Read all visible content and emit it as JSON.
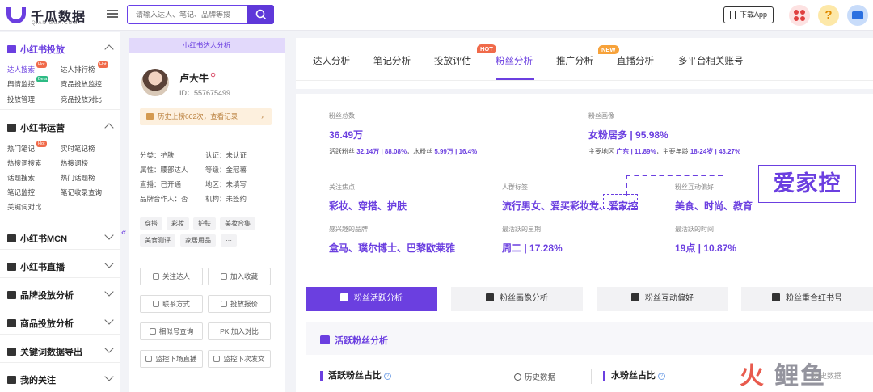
{
  "app": {
    "logo_name": "千瓜数据",
    "logo_sub": "QIAN-GUA.COM"
  },
  "search": {
    "placeholder": "请输入达人、笔记、品牌等搜"
  },
  "topbar": {
    "download_label": "下载App",
    "help_glyph": "?"
  },
  "sidebar": {
    "groups": [
      {
        "title": "小红书投放",
        "items": [
          "达人搜索",
          "达人排行榜",
          "舆情监控",
          "竞品投放监控",
          "投放管理",
          "竞品投放对比"
        ],
        "tags": {
          "hot1": "Hot",
          "hot2": "Hot",
          "beta": "Beta"
        }
      },
      {
        "title": "小红书运营",
        "items": [
          "热门笔记",
          "实时笔记榜",
          "热搜词搜索",
          "热搜词榜",
          "话题搜索",
          "热门话题榜",
          "笔记监控",
          "笔记收录查询",
          "关键词对比"
        ],
        "tags": {
          "hot": "Hot"
        }
      },
      {
        "title": "小红书MCN"
      },
      {
        "title": "小红书直播"
      },
      {
        "title": "品牌投放分析"
      },
      {
        "title": "商品投放分析"
      },
      {
        "title": "关键词数据导出"
      },
      {
        "title": "我的关注"
      }
    ],
    "collapse_glyph": "«"
  },
  "profile": {
    "header": "小红书达人分析",
    "name": "卢大牛",
    "id": "ID：557675499",
    "history": "历史上榜602次，查看记录",
    "history_arrow": "›",
    "attrs": [
      "分类：护肤",
      "认证：未认证",
      "属性：腰部达人",
      "等级：金冠薯",
      "直播：已开通",
      "地区：未填写",
      "品牌合作人：否",
      "机构：未签约"
    ],
    "tags": [
      "穿搭",
      "彩妆",
      "护肤",
      "美妆合集",
      "美食测评",
      "家居用品",
      "···"
    ],
    "buttons": [
      "关注达人",
      "加入收藏",
      "联系方式",
      "投放报价",
      "相似号查询",
      "PK 加入对比",
      "监控下场直播",
      "监控下次发文"
    ]
  },
  "tabs": {
    "items": [
      "达人分析",
      "笔记分析",
      "投放评估",
      "粉丝分析",
      "推广分析",
      "直播分析",
      "多平台相关账号"
    ],
    "active": "粉丝分析",
    "hot_badge": "HOT",
    "new_badge": "NEW"
  },
  "stats": {
    "fans_total_label": "粉丝总数",
    "fans_total": "36.49万",
    "fans_total_sub_a_label": "活跃粉丝",
    "fans_total_sub_a": "32.14万 | 88.08%",
    "fans_total_sub_b_label": "水粉丝",
    "fans_total_sub_b": "5.99万 | 16.4%",
    "portrait_label": "粉丝画像",
    "portrait": "女粉居多 | 95.98%",
    "portrait_sub_a_label": "主要地区",
    "portrait_sub_a": "广东 | 11.89%",
    "portrait_sub_b_label": "主要年龄",
    "portrait_sub_b": "18-24岁 | 43.27%",
    "focus_label": "关注焦点",
    "focus": "彩妆、穿搭、护肤",
    "crowd_label": "人群标签",
    "crowd": "流行男女、爱买彩妆党、爱家控",
    "interact_label": "粉丝互动偏好",
    "interact": "美食、时尚、教育",
    "brand_label": "感兴趣的品牌",
    "brand": "盒马、璞尔博士、巴黎欧莱雅",
    "active_week_label": "最活跃的星期",
    "active_week": "周二 | 17.28%",
    "active_time_label": "最活跃的时间",
    "active_time": "19点 | 10.87%",
    "callout": "爱家控"
  },
  "subtabs": [
    "粉丝活跃分析",
    "粉丝画像分析",
    "粉丝互动偏好",
    "粉丝重合红书号"
  ],
  "section": {
    "title": "活跃粉丝分析",
    "left_title": "活跃粉丝占比",
    "history": "历史数据",
    "right_title": "水粉丝占比",
    "qmark": "?"
  },
  "watermark": {
    "fire": "火",
    "rest": "鲤鱼",
    "small": "历史数据"
  },
  "colors": {
    "accent": "#6b3fe0",
    "hot": "#f06a4a",
    "new": "#f7a23a",
    "beta": "#2dbb84"
  }
}
